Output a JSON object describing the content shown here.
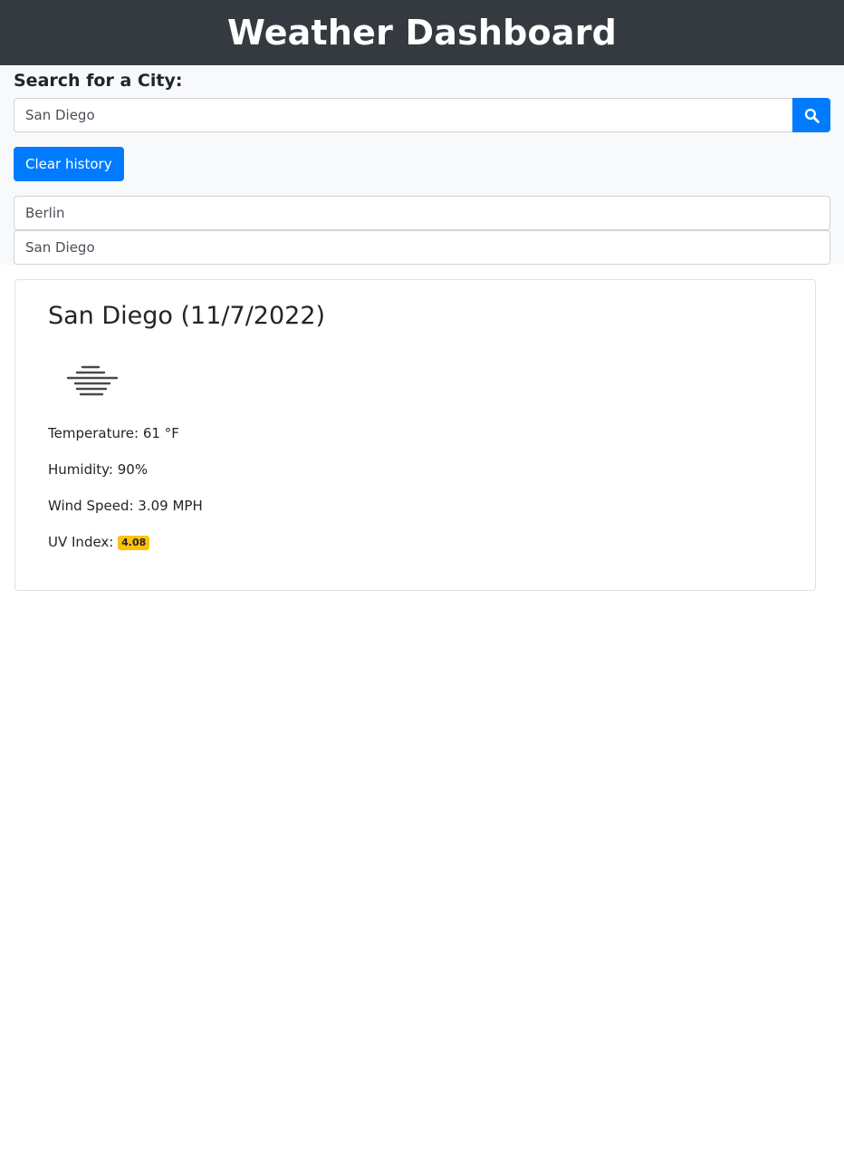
{
  "header": {
    "title": "Weather Dashboard"
  },
  "search": {
    "label": "Search for a City:",
    "value": "San Diego",
    "button_icon": "search-icon",
    "clear_label": "Clear history"
  },
  "history": [
    "Berlin",
    "San Diego"
  ],
  "current": {
    "title": "San Diego (11/7/2022)",
    "icon": "mist-icon",
    "temperature": "Temperature: 61 °F",
    "humidity": "Humidity: 90%",
    "wind": "Wind Speed: 3.09 MPH",
    "uv_label": "UV Index: ",
    "uv_value": "4.08"
  },
  "colors": {
    "header_bg": "#343a40",
    "primary": "#007bff",
    "uv_badge": "#ffc107",
    "panel_bg": "#f8f9fa"
  }
}
